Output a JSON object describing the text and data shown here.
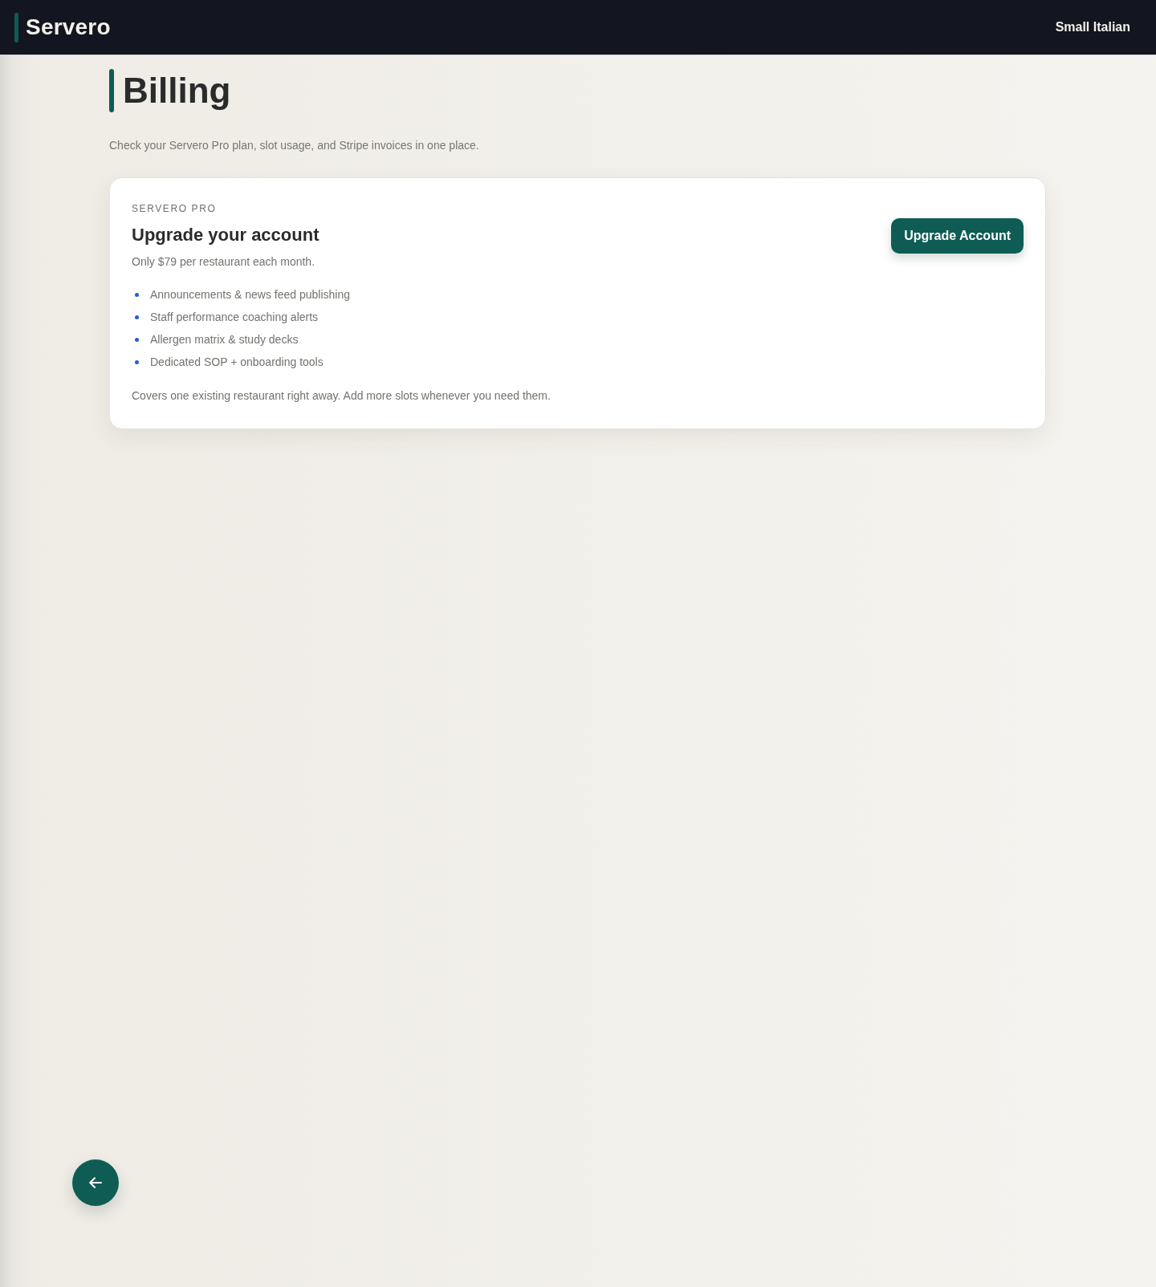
{
  "header": {
    "brand": "Servero",
    "account": "Small Italian"
  },
  "page": {
    "title": "Billing",
    "subtitle": "Check your Servero Pro plan, slot usage, and Stripe invoices in one place."
  },
  "plan_card": {
    "eyebrow": "SERVERO PRO",
    "title": "Upgrade your account",
    "price": "Only $79 per restaurant each month.",
    "features": [
      "Announcements & news feed publishing",
      "Staff performance coaching alerts",
      "Allergen matrix & study decks",
      "Dedicated SOP + onboarding tools"
    ],
    "note": "Covers one existing restaurant right away. Add more slots whenever you need them.",
    "button": "Upgrade Account"
  }
}
